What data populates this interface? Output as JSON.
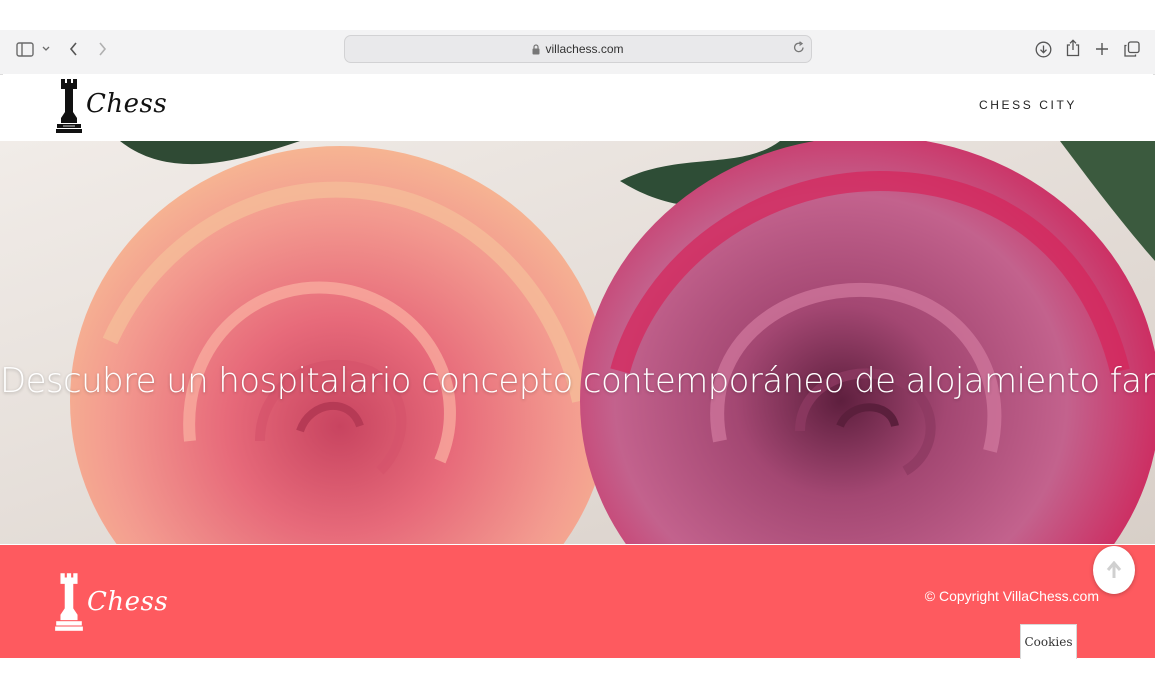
{
  "browser": {
    "url": "villachess.com"
  },
  "header": {
    "logo_text": "Chess",
    "nav_link": "CHESS CITY"
  },
  "hero": {
    "title": "Descubre un hospitalario concepto contemporáneo de alojamiento familiar"
  },
  "footer": {
    "logo_text": "Chess",
    "copyright": "© Copyright VillaChess.com",
    "cookies_label": "Cookies"
  },
  "colors": {
    "footer_bg": "#fe5a5f",
    "header_bg": "#ffffff",
    "chrome_bg": "#f3f3f4"
  },
  "icons": [
    "sidebar-icon",
    "chevron-down-icon",
    "back-icon",
    "forward-icon",
    "lock-icon",
    "reload-icon",
    "download-icon",
    "share-icon",
    "plus-icon",
    "tabs-icon",
    "rook-icon",
    "arrow-up-icon"
  ]
}
